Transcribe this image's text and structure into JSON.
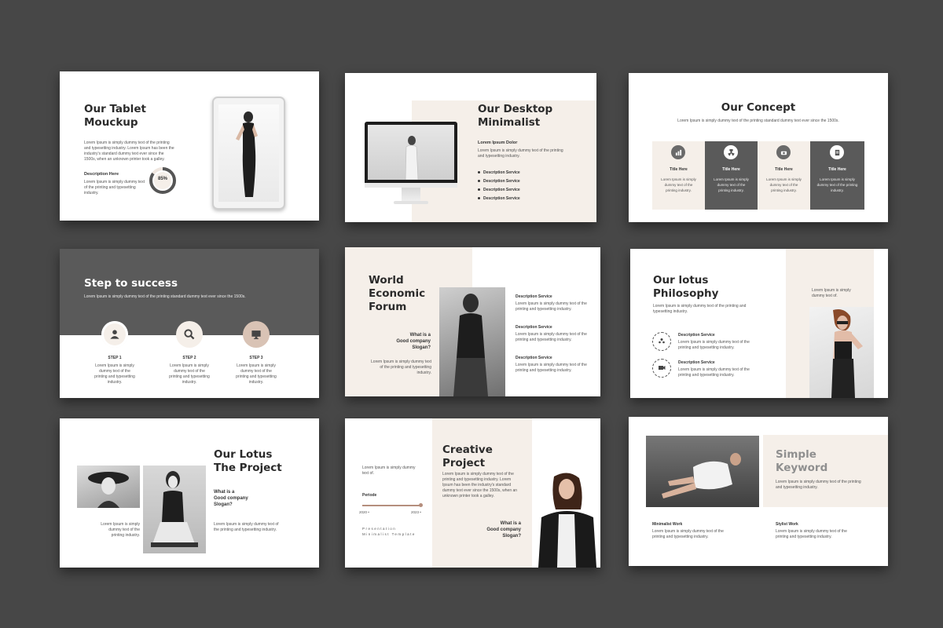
{
  "lorem_long": "Lorem Ipsum is simply dummy text of the printing and typesetting industry. Lorem Ipsum has been the industry's standard dummy text ever since the 1500s, when an unknown printer took a galley.",
  "lorem_short": "Lorem Ipsum is simply dummy text of the printing and typesetting industry.",
  "lorem_tiny": "Lorem Ipsum is simply dummy text of the printing industry.",
  "s1": {
    "title_l1": "Our Tablet",
    "title_l2": "Mouckup",
    "desc_head": "Description Here",
    "percent": "85%",
    "progress": 0.85
  },
  "s2": {
    "title_l1": "Our Desktop",
    "title_l2": "Minimalist",
    "sub": "Lorem Ipsum Dolor",
    "services": [
      "Description Service",
      "Description Service",
      "Description Service",
      "Description Service"
    ]
  },
  "s3": {
    "title": "Our Concept",
    "sub": "Lorem Ipsum is simply dummy text of the printing standard dummy text ever since the 1500s.",
    "cards": [
      {
        "label": "Title Here",
        "icon": "chart-icon"
      },
      {
        "label": "Title Here",
        "icon": "nuclear-icon"
      },
      {
        "label": "Title Here",
        "icon": "camera-icon"
      },
      {
        "label": "Title Here",
        "icon": "book-icon"
      }
    ]
  },
  "s4": {
    "title": "Step to success",
    "sub": "Lorem Ipsum is simply dummy text of the printing standard dummy text ever since the 1500s.",
    "steps": [
      {
        "label": "STEP 1",
        "icon": "user-icon"
      },
      {
        "label": "STEP 2",
        "icon": "search-icon"
      },
      {
        "label": "STEP 3",
        "icon": "monitor-icon"
      }
    ],
    "step_text": "Lorem Ipsum is simply dummy text of the printing and typesetting industry."
  },
  "s5": {
    "title_l1": "World",
    "title_l2": "Economic",
    "title_l3": "Forum",
    "q1": "What is a",
    "q2": "Good company",
    "q3": "Slogan?",
    "services": [
      "Description Service",
      "Description Service",
      "Description Service"
    ]
  },
  "s6": {
    "title_l1": "Our lotus",
    "title_l2": "Philosophy",
    "services": [
      "Description Service",
      "Description Service"
    ],
    "side_text": "Lorem Ipsum is simply dummy text of."
  },
  "s7": {
    "title_l1": "Our Lotus",
    "title_l2": "The Project",
    "q1": "What is a",
    "q2": "Good company",
    "q3": "Slogan?"
  },
  "s8": {
    "title_l1": "Creative",
    "title_l2": "Project",
    "side_top": "Lorem Ipsum is simply dummy text of.",
    "periode": "Periode",
    "years": [
      "2020 •",
      "2023 •"
    ],
    "caption1": "Presentation",
    "caption2": "Minimalist Template",
    "q1": "What is a",
    "q2": "Good company",
    "q3": "Slogan?"
  },
  "s9": {
    "title_l1": "Simple",
    "title_l2": "Keyword",
    "col1": "Minimalist Work",
    "col2": "Stylist Work"
  },
  "colors": {
    "background": "#474747",
    "beige": "#f5efe9",
    "dark_gray": "#5a5a5a",
    "accent": "#c9a99a"
  }
}
